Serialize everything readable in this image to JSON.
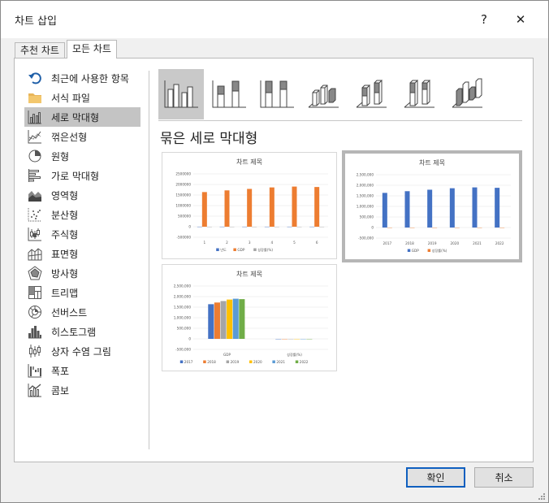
{
  "window": {
    "title": "차트 삽입",
    "help_label": "?",
    "close_label": "✕"
  },
  "tabs": [
    {
      "label": "추천 차트",
      "active": false
    },
    {
      "label": "모든 차트",
      "active": true
    }
  ],
  "sidebar": {
    "items": [
      {
        "label": "최근에 사용한 항목",
        "icon": "recent-icon"
      },
      {
        "label": "서식 파일",
        "icon": "folder-icon"
      },
      {
        "label": "세로 막대형",
        "icon": "column-chart-icon",
        "selected": true
      },
      {
        "label": "꺾은선형",
        "icon": "line-chart-icon"
      },
      {
        "label": "원형",
        "icon": "pie-chart-icon"
      },
      {
        "label": "가로 막대형",
        "icon": "bar-chart-icon"
      },
      {
        "label": "영역형",
        "icon": "area-chart-icon"
      },
      {
        "label": "분산형",
        "icon": "scatter-chart-icon"
      },
      {
        "label": "주식형",
        "icon": "stock-chart-icon"
      },
      {
        "label": "표면형",
        "icon": "surface-chart-icon"
      },
      {
        "label": "방사형",
        "icon": "radar-chart-icon"
      },
      {
        "label": "트리맵",
        "icon": "treemap-icon"
      },
      {
        "label": "선버스트",
        "icon": "sunburst-icon"
      },
      {
        "label": "히스토그램",
        "icon": "histogram-icon"
      },
      {
        "label": "상자 수염 그림",
        "icon": "box-whisker-icon"
      },
      {
        "label": "폭포",
        "icon": "waterfall-icon"
      },
      {
        "label": "콤보",
        "icon": "combo-chart-icon"
      }
    ]
  },
  "section_title": "묶은 세로 막대형",
  "subtypes": [
    {
      "name": "clustered-column",
      "selected": true
    },
    {
      "name": "stacked-column"
    },
    {
      "name": "100-stacked-column"
    },
    {
      "name": "3d-clustered-column"
    },
    {
      "name": "3d-stacked-column"
    },
    {
      "name": "3d-100-stacked-column"
    },
    {
      "name": "3d-column"
    }
  ],
  "previews": [
    {
      "title": "차트 제목",
      "selected": false,
      "y_ticks": [
        "2500000",
        "2000000",
        "1500000",
        "1000000",
        "500000",
        "0",
        "-500000"
      ],
      "x_labels": [
        "1",
        "2",
        "3",
        "4",
        "5",
        "6"
      ],
      "legend": [
        {
          "label": "년도",
          "color": "#4472c4"
        },
        {
          "label": "GDP",
          "color": "#ed7d31"
        },
        {
          "label": "성장률(%)",
          "color": "#a5a5a5"
        }
      ]
    },
    {
      "title": "차트 제목",
      "selected": true,
      "y_ticks": [
        "2,500,000",
        "2,000,000",
        "1,500,000",
        "1,000,000",
        "500,000",
        "0",
        "-500,000"
      ],
      "x_labels": [
        "2017",
        "2018",
        "2019",
        "2020",
        "2021",
        "2022"
      ],
      "legend": [
        {
          "label": "GDP",
          "color": "#4472c4"
        },
        {
          "label": "성장률(%)",
          "color": "#ed7d31"
        }
      ]
    },
    {
      "title": "차트 제목",
      "selected": false,
      "y_ticks": [
        "2,500,000",
        "2,000,000",
        "1,500,000",
        "1,000,000",
        "500,000",
        "0",
        "-500,000"
      ],
      "x_labels": [
        "GDP",
        "성장률(%)"
      ],
      "legend": [
        {
          "label": "2017",
          "color": "#4472c4"
        },
        {
          "label": "2018",
          "color": "#ed7d31"
        },
        {
          "label": "2019",
          "color": "#a5a5a5"
        },
        {
          "label": "2020",
          "color": "#ffc000"
        },
        {
          "label": "2021",
          "color": "#5b9bd5"
        },
        {
          "label": "2022",
          "color": "#70ad47"
        }
      ]
    }
  ],
  "chart_data": [
    {
      "type": "bar",
      "title": "차트 제목",
      "categories": [
        "1",
        "2",
        "3",
        "4",
        "5",
        "6"
      ],
      "series": [
        {
          "name": "년도",
          "values": [
            2017,
            2018,
            2019,
            2020,
            2021,
            2022
          ]
        },
        {
          "name": "GDP",
          "values": [
            1640000,
            1720000,
            1790000,
            1860000,
            1900000,
            1880000
          ]
        },
        {
          "name": "성장률(%)",
          "values": [
            3.2,
            2.9,
            2.2,
            -0.7,
            4.3,
            2.6
          ]
        }
      ],
      "ylim": [
        -500000,
        2500000
      ]
    },
    {
      "type": "bar",
      "title": "차트 제목",
      "categories": [
        "2017",
        "2018",
        "2019",
        "2020",
        "2021",
        "2022"
      ],
      "series": [
        {
          "name": "GDP",
          "values": [
            1640000,
            1720000,
            1790000,
            1860000,
            1900000,
            1880000
          ]
        },
        {
          "name": "성장률(%)",
          "values": [
            3.2,
            2.9,
            2.2,
            -0.7,
            4.3,
            2.6
          ]
        }
      ],
      "ylim": [
        -500000,
        2500000
      ]
    },
    {
      "type": "bar",
      "title": "차트 제목",
      "categories": [
        "GDP",
        "성장률(%)"
      ],
      "series": [
        {
          "name": "2017",
          "values": [
            1640000,
            3.2
          ]
        },
        {
          "name": "2018",
          "values": [
            1720000,
            2.9
          ]
        },
        {
          "name": "2019",
          "values": [
            1790000,
            2.2
          ]
        },
        {
          "name": "2020",
          "values": [
            1860000,
            -0.7
          ]
        },
        {
          "name": "2021",
          "values": [
            1900000,
            4.3
          ]
        },
        {
          "name": "2022",
          "values": [
            1880000,
            2.6
          ]
        }
      ],
      "ylim": [
        -500000,
        2500000
      ]
    }
  ],
  "buttons": {
    "ok": "확인",
    "cancel": "취소"
  }
}
